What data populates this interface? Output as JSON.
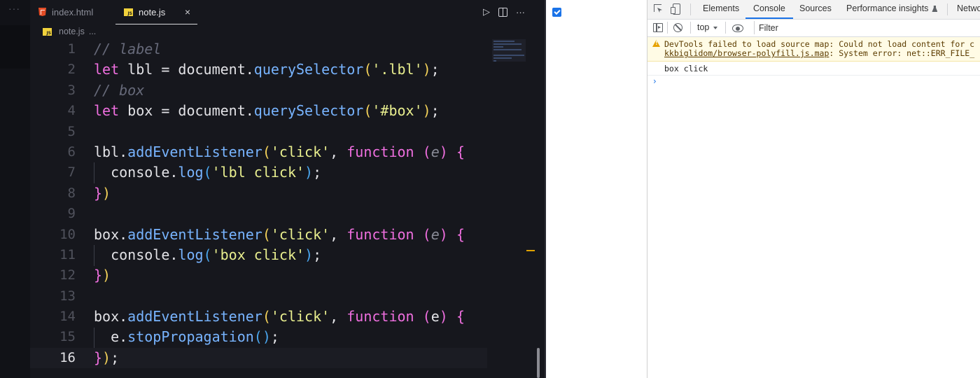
{
  "editor": {
    "activity_dots": "···",
    "tabs": [
      {
        "label": "index.html",
        "icon": "html5-icon"
      },
      {
        "label": "note.js",
        "icon": "js-file-icon",
        "active": true,
        "close": "×"
      }
    ],
    "actions": {
      "run": "▷",
      "more": "···"
    },
    "breadcrumb": {
      "file": "note.js",
      "ellipsis": "..."
    },
    "js_icon_text": "JS",
    "active_line": "16",
    "line_numbers": [
      "1",
      "2",
      "3",
      "4",
      "5",
      "6",
      "7",
      "8",
      "9",
      "10",
      "11",
      "12",
      "13",
      "14",
      "15",
      "16"
    ],
    "code_lines": [
      "// label",
      "let lbl = document.querySelector('.lbl');",
      "// box",
      "let box = document.querySelector('#box');",
      "",
      "lbl.addEventListener('click', function (e) {",
      "  console.log('lbl click');",
      "})",
      "",
      "box.addEventListener('click', function (e) {",
      "  console.log('box click');",
      "})",
      "",
      "box.addEventListener('click', function (e) {",
      "  e.stopPropagation();",
      "});"
    ],
    "colors": {
      "background": "#16171d",
      "keyword": "#ef6fdf",
      "function": "#78b4ff",
      "string": "#e9ef8f",
      "comment": "#676a7a"
    }
  },
  "preview": {
    "checkbox_checked": true,
    "checkbox_color": "#1a73e8"
  },
  "devtools": {
    "tabs": [
      "Elements",
      "Console",
      "Sources",
      "Performance insights",
      "Netwo"
    ],
    "active_tab": "Console",
    "context": "top",
    "filter_placeholder": "Filter",
    "warning": {
      "line1": "DevTools failed to load source map: Could not load content for c",
      "line2_link": "kkbiglidom/browser-polyfill.js.map",
      "line2_rest": ": System error: net::ERR_FILE_"
    },
    "log": "box click",
    "prompt": "›",
    "colors": {
      "accent": "#1a73e8",
      "warning_bg": "#fffbe5"
    }
  }
}
